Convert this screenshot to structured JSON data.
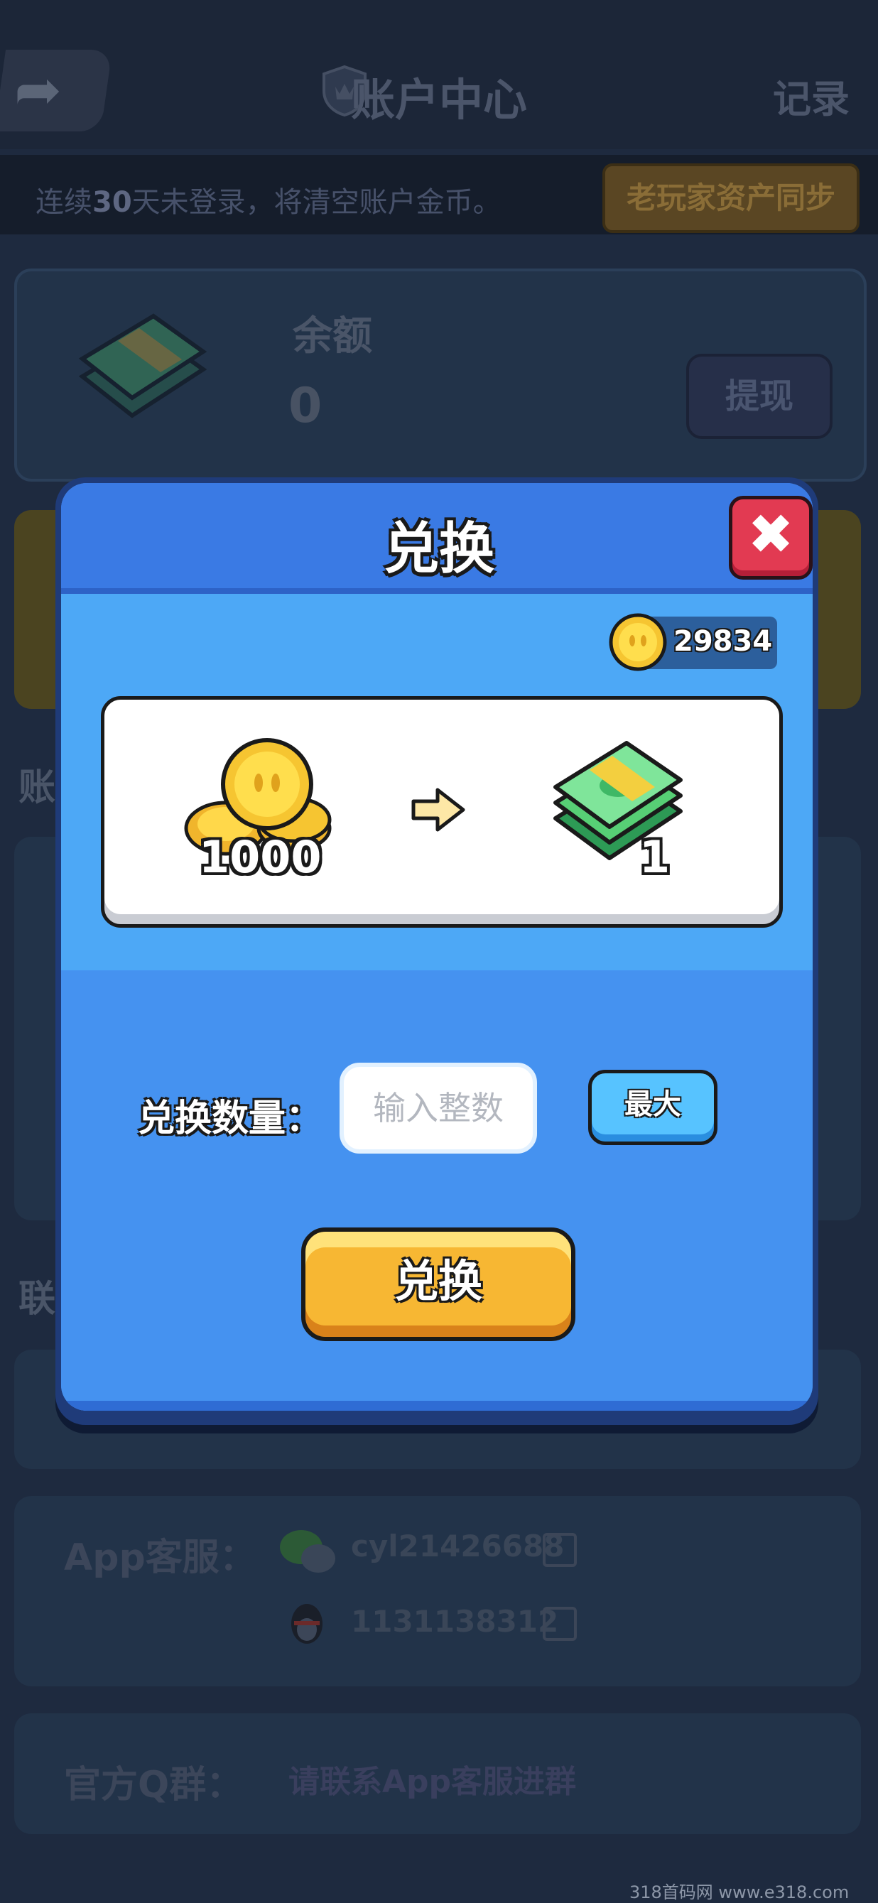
{
  "header": {
    "title": "账户中心",
    "record_label": "记录"
  },
  "notice": {
    "text_prefix": "连续",
    "text_days": "30",
    "text_suffix": "天未登录，将清空账户金币。",
    "sync_button": "老玩家资产同步"
  },
  "balance": {
    "label": "余额",
    "value": "0",
    "withdraw_button": "提现"
  },
  "sections": {
    "account_label_partial": "账",
    "contact_label_partial": "联"
  },
  "support": {
    "app_label": "App客服：",
    "wechat_id": "cyl21426688",
    "qq_id": "1131138312",
    "group_label": "官方Q群：",
    "group_text": "请联系App客服进群"
  },
  "modal": {
    "title": "兑换",
    "coin_balance": "29834",
    "rate": {
      "coins_amount": "1000",
      "cash_amount": "1"
    },
    "quantity_label": "兑换数量：",
    "quantity_placeholder": "输入整数",
    "quantity_value": "",
    "max_button": "最大",
    "exchange_button": "兑换"
  },
  "colors": {
    "modal_blue": "#3f8bef",
    "header_blue": "#3a7ae4",
    "close_red": "#e23a52",
    "button_gold": "#f7b733",
    "max_blue": "#57c3ff"
  },
  "icons": {
    "back": "back-arrow-icon",
    "header": "shield-crown-icon",
    "close": "close-x-icon",
    "coin": "gold-coin-icon",
    "cash": "cash-stack-icon",
    "arrow": "right-arrow-icon",
    "wechat": "wechat-icon",
    "qq": "qq-penguin-icon",
    "copy": "copy-icon"
  },
  "watermark": "318首码网 www.e318.com"
}
